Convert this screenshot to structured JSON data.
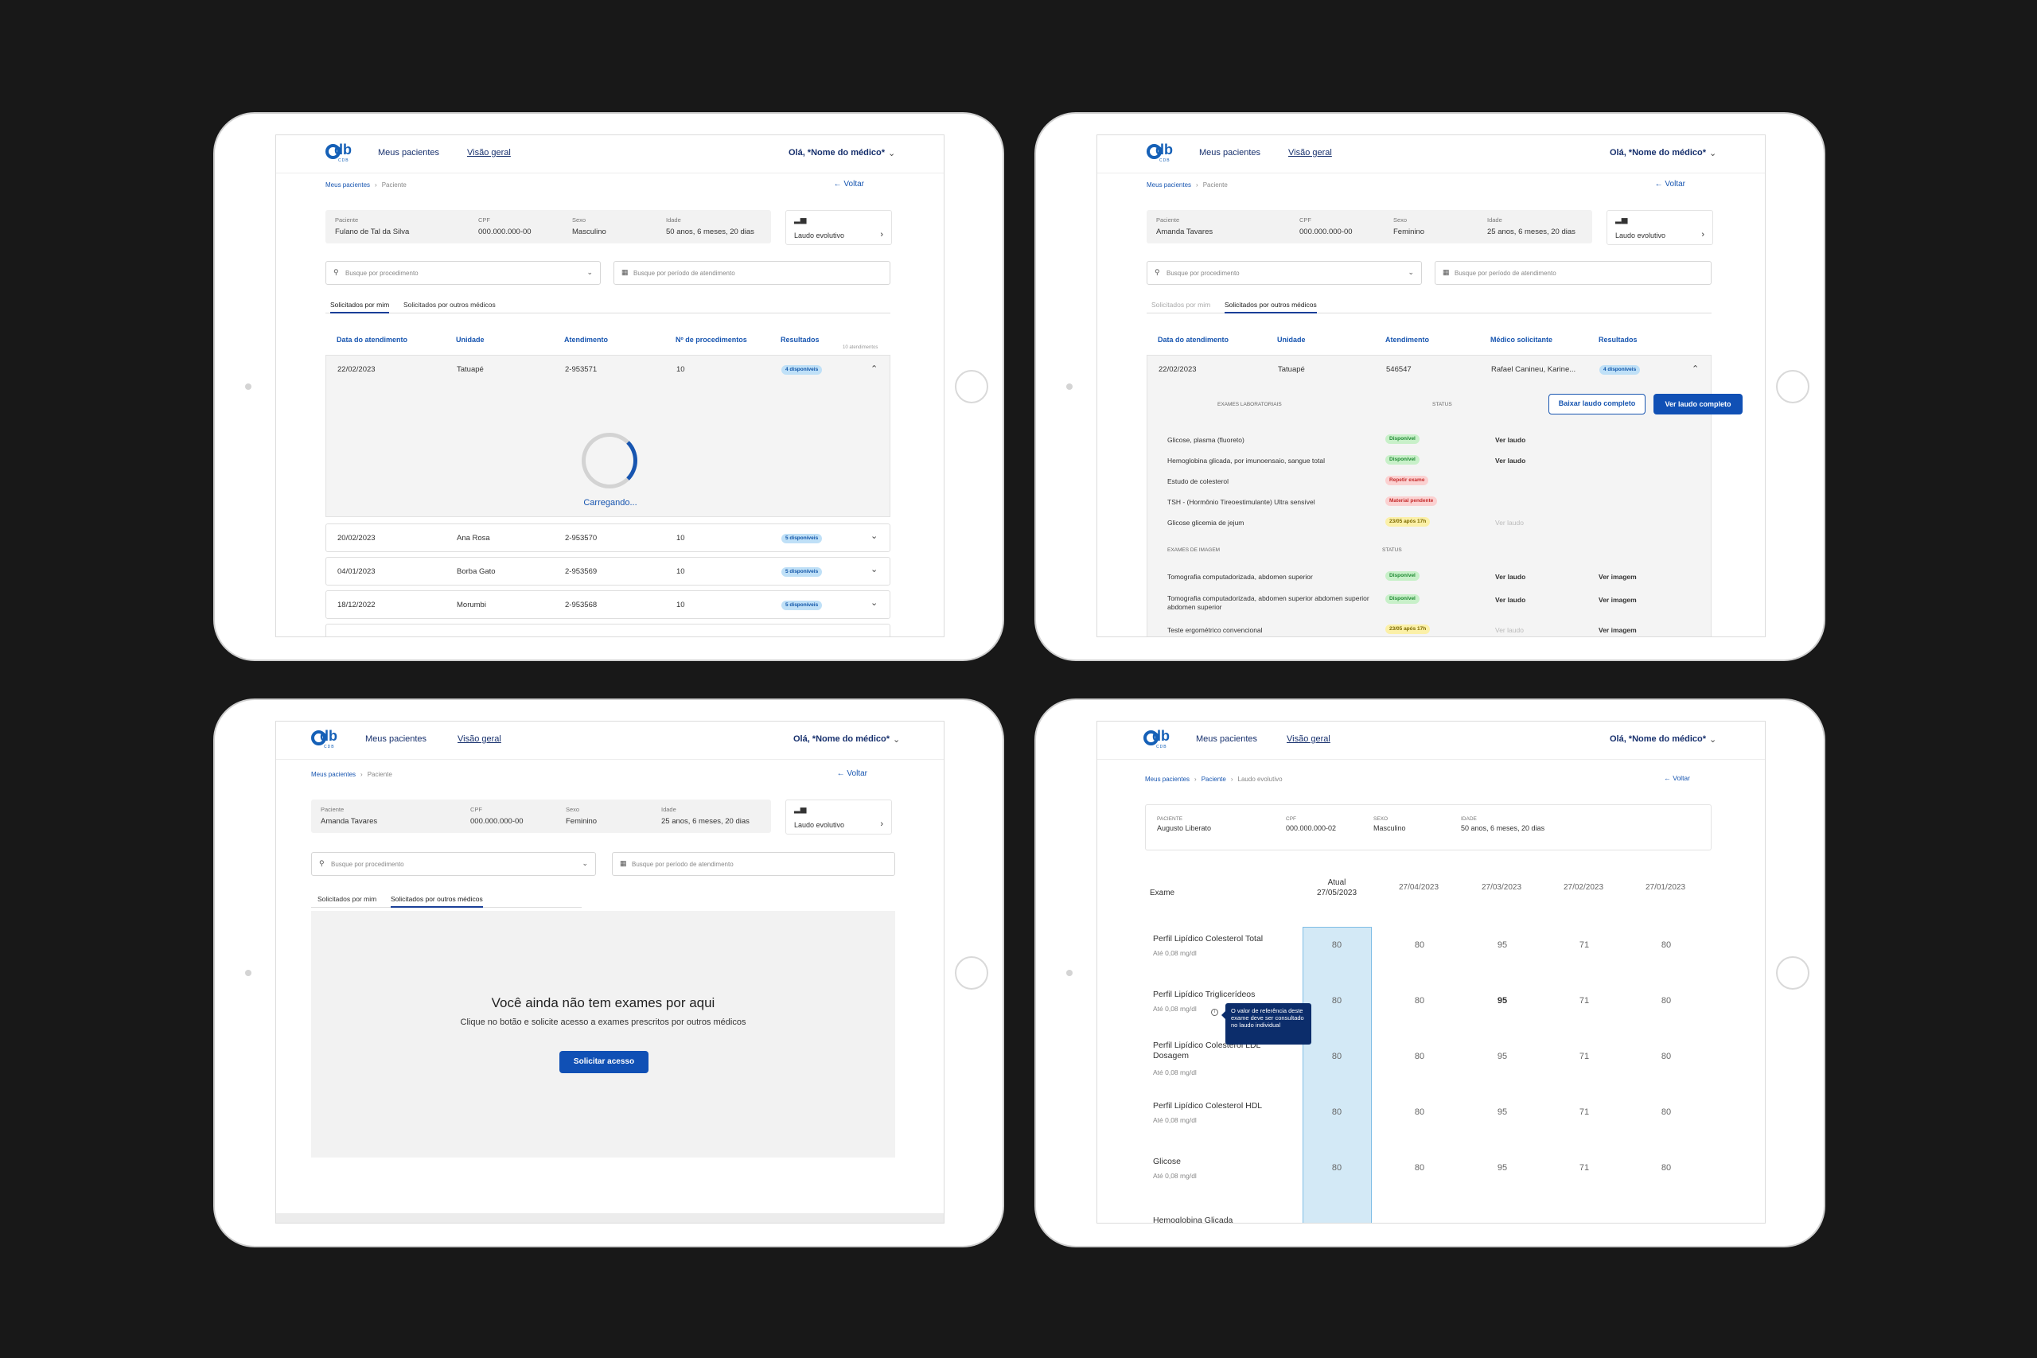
{
  "nav": {
    "my_patients": "Meus pacientes",
    "overview": "Visão geral",
    "greeting": "Olá, *Nome do médico*",
    "back": "Voltar"
  },
  "common": {
    "crumb_patients": "Meus pacientes",
    "crumb_patient": "Paciente",
    "crumb_report": "Laudo evolutivo",
    "laudo_label": "Laudo evolutivo",
    "search_proc_placeholder": "Busque por procedimento",
    "search_period_placeholder": "Busque por período de atendimento",
    "tab_mine": "Solicitados por mim",
    "tab_others": "Solicitados por outros médicos"
  },
  "s1": {
    "patient": {
      "l_name": "Paciente",
      "name": "Fulano de Tal da Silva",
      "l_cpf": "CPF",
      "cpf": "000.000.000-00",
      "l_sex": "Sexo",
      "sex": "Masculino",
      "l_age": "Idade",
      "age": "50 anos, 6 meses, 20 dias"
    },
    "headers": {
      "date": "Data do atendimento",
      "unit": "Unidade",
      "visit": "Atendimento",
      "procs": "Nº de procedimentos",
      "results": "Resultados",
      "count": "10 atendimentos"
    },
    "expanded": {
      "date": "22/02/2023",
      "unit": "Tatuapé",
      "visit": "2-953571",
      "procs": "10",
      "badge": "4 disponíveis"
    },
    "loading": "Carregando...",
    "rows": [
      {
        "date": "20/02/2023",
        "unit": "Ana Rosa",
        "visit": "2-953570",
        "procs": "10",
        "badge": "5 disponíveis"
      },
      {
        "date": "04/01/2023",
        "unit": "Borba Gato",
        "visit": "2-953569",
        "procs": "10",
        "badge": "5 disponíveis"
      },
      {
        "date": "18/12/2022",
        "unit": "Morumbi",
        "visit": "2-953568",
        "procs": "10",
        "badge": "5 disponíveis"
      }
    ]
  },
  "s2": {
    "patient": {
      "l_name": "Paciente",
      "name": "Amanda Tavares",
      "l_cpf": "CPF",
      "cpf": "000.000.000-00",
      "l_sex": "Sexo",
      "sex": "Feminino",
      "l_age": "Idade",
      "age": "25 anos, 6 meses, 20 dias"
    },
    "headers": {
      "date": "Data do atendimento",
      "unit": "Unidade",
      "visit": "Atendimento",
      "doctor": "Médico solicitante",
      "results": "Resultados"
    },
    "expanded": {
      "date": "22/02/2023",
      "unit": "Tatuapé",
      "visit": "546547",
      "doctor": "Rafael Canineu, Karine...",
      "badge": "4 disponíveis"
    },
    "download": "Baixar laudo completo",
    "view": "Ver laudo completo",
    "lab_title": "Exames laboratoriais",
    "status_title": "Status",
    "lab": [
      {
        "name": "Glicose, plasma (fluoreto)",
        "status": "Disponível",
        "action": "Ver laudo"
      },
      {
        "name": "Hemoglobina glicada, por imunoensaio, sangue total",
        "status": "Disponível",
        "action": "Ver laudo"
      },
      {
        "name": "Estudo de colesterol",
        "status": "Repetir exame",
        "action": ""
      },
      {
        "name": "TSH - (Hormônio Tireoestimulante) Ultra sensível",
        "status": "Material pendente",
        "action": ""
      },
      {
        "name": "Glicose glicemia de jejum",
        "status": "23/05 após 17h",
        "action": "Ver laudo"
      }
    ],
    "img_title": "Exames de imagem",
    "img": [
      {
        "name": "Tomografia computadorizada, abdomen superior",
        "status": "Disponível",
        "action": "Ver laudo",
        "image": "Ver imagem"
      },
      {
        "name": "Tomografia computadorizada, abdomen superior abdomen superior abdomen superior",
        "status": "Disponível",
        "action": "Ver laudo",
        "image": "Ver imagem"
      },
      {
        "name": "Teste ergométrico convencional",
        "status": "23/05 após 17h",
        "action": "Ver laudo",
        "image": "Ver imagem"
      }
    ]
  },
  "s3": {
    "patient": {
      "l_name": "Paciente",
      "name": "Amanda Tavares",
      "l_cpf": "CPF",
      "cpf": "000.000.000-00",
      "l_sex": "Sexo",
      "sex": "Feminino",
      "l_age": "Idade",
      "age": "25 anos, 6 meses, 20 dias"
    },
    "empty_title": "Você ainda não tem exames por aqui",
    "empty_sub": "Clique no botão e solicite acesso a exames prescritos por outros médicos",
    "request": "Solicitar acesso"
  },
  "s4": {
    "patient": {
      "l_name": "PACIENTE",
      "name": "Augusto Liberato",
      "l_cpf": "CPF",
      "cpf": "000.000.000-02",
      "l_sex": "SEXO",
      "sex": "Masculino",
      "l_age": "IDADE",
      "age": "50 anos, 6 meses, 20 dias"
    },
    "exam_header": "Exame",
    "current_label": "Atual",
    "dates": [
      "27/05/2023",
      "27/04/2023",
      "27/03/2023",
      "27/02/2023",
      "27/01/2023"
    ],
    "exams": [
      {
        "name": "Perfil Lipídico Colesterol Total",
        "ref": "Até 0,08 mg/dl",
        "values": [
          "80",
          "80",
          "95",
          "71",
          "80"
        ]
      },
      {
        "name": "Perfil Lipídico Triglicerídeos",
        "ref": "Até 0,08 mg/dl",
        "values": [
          "80",
          "80",
          "95",
          "71",
          "80"
        ]
      },
      {
        "name": "Perfil Lipídico Colesterol LDL Dosagem",
        "ref": "Até 0,08 mg/dl",
        "values": [
          "80",
          "80",
          "95",
          "71",
          "80"
        ]
      },
      {
        "name": "Perfil Lipídico Colesterol HDL",
        "ref": "Até 0,08 mg/dl",
        "values": [
          "80",
          "80",
          "95",
          "71",
          "80"
        ]
      },
      {
        "name": "Glicose",
        "ref": "Até 0,08 mg/dl",
        "values": [
          "80",
          "80",
          "95",
          "71",
          "80"
        ]
      },
      {
        "name": "Hemoglobina Glicada",
        "ref": "",
        "values": []
      }
    ],
    "tooltip": "O valor de referência deste exame deve ser consultado no laudo individual"
  },
  "colors": {
    "primary": "#1050b5",
    "link": "#1755b0",
    "nav": "#17306d",
    "highlight": "#d3e9f6",
    "badge_blue": "#bfe0f7",
    "badge_green": "#c8f0c9",
    "badge_red": "#fbd1d1",
    "badge_yellow": "#fbf0a8"
  },
  "icons": [
    "search-icon",
    "calendar-icon",
    "chevron-down-icon",
    "chevron-up-icon",
    "chevron-right-icon",
    "arrow-left-icon",
    "chart-icon",
    "info-icon"
  ]
}
